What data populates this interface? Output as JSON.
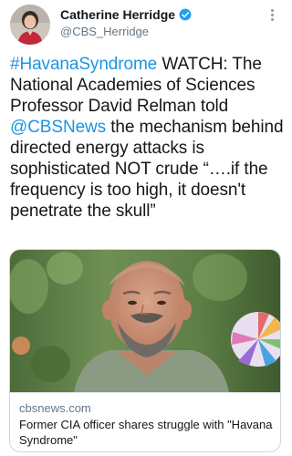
{
  "author": {
    "display_name": "Catherine Herridge",
    "handle": "@CBS_Herridge",
    "verified": true
  },
  "tweet": {
    "hashtag": "#HavanaSyndrome",
    "text_1": " WATCH: The National Academies of Sciences Professor David Relman told ",
    "mention": "@CBSNews",
    "text_2": " the mechanism behind directed energy attacks is sophisticated NOT crude “….if the frequency is too high, it doesn't penetrate the skull”"
  },
  "card": {
    "domain": "cbsnews.com",
    "title": "Former CIA officer shares struggle with \"Havana Syndrome\""
  },
  "icons": {
    "verified": "verified-badge-icon",
    "more": "more-options-icon"
  },
  "colors": {
    "link": "#1b95e0",
    "secondary_text": "#657786",
    "primary_text": "#14171a"
  }
}
